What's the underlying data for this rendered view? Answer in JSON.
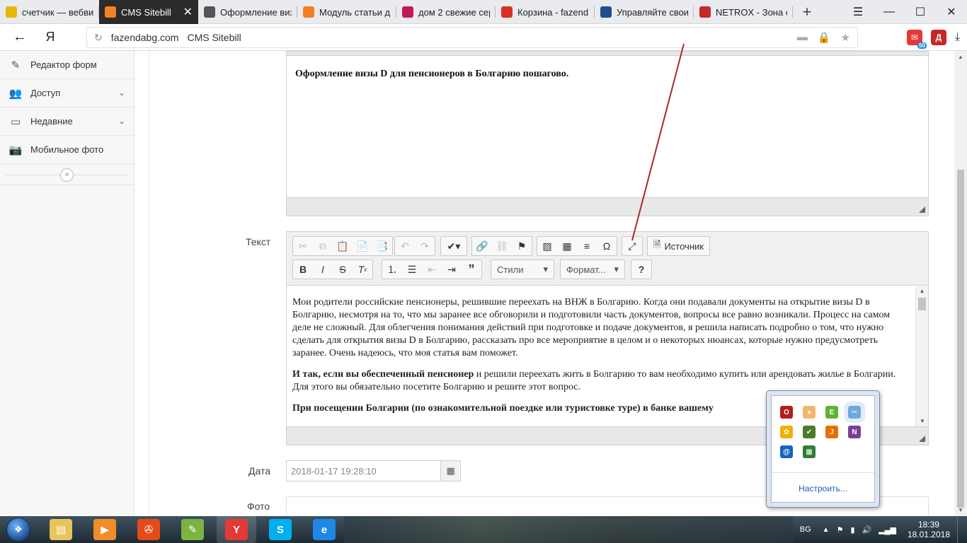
{
  "browser": {
    "tabs": [
      {
        "title": "счетчик — вебви",
        "favicon": "yandex-metrika-icon",
        "color": "#e8b700"
      },
      {
        "title": "CMS Sitebill",
        "favicon": "sitebill-icon",
        "color": "#f48024",
        "active": true
      },
      {
        "title": "Оформление виз",
        "favicon": "house-icon",
        "color": "#555555"
      },
      {
        "title": "Модуль статьи д",
        "favicon": "sitebill-icon",
        "color": "#f48024"
      },
      {
        "title": "дом 2 свежие сер",
        "favicon": "dom2-icon",
        "color": "#c2185b"
      },
      {
        "title": "Корзина - fazend",
        "favicon": "gmail-icon",
        "color": "#d93025"
      },
      {
        "title": "Управляйте свои",
        "favicon": "blogger-b-icon",
        "color": "#1e4e8c"
      },
      {
        "title": "NETROX - Зона о",
        "favicon": "netrox-icon",
        "color": "#c62828"
      }
    ],
    "close_glyph": "✕",
    "new_tab_glyph": "+",
    "window_controls": {
      "menu": "☰",
      "minimize": "—",
      "maximize": "☐",
      "close": "✕"
    },
    "back_glyph": "←",
    "yandex_glyph": "Я",
    "url_domain": "fazendabg.com",
    "url_title": "CMS Sitebill",
    "extensions": [
      {
        "name": "mail-icon",
        "color": "#e53935",
        "badge": "50"
      },
      {
        "name": "d-icon",
        "color": "#c62828",
        "label": "Д"
      }
    ]
  },
  "sidebar": {
    "items": [
      {
        "label": "Редактор форм",
        "icon": "edit-icon",
        "glyph": "✎"
      },
      {
        "label": "Доступ",
        "icon": "users-icon",
        "glyph": "👥",
        "expandable": true
      },
      {
        "label": "Недавние",
        "icon": "monitor-icon",
        "glyph": "▭",
        "expandable": true
      },
      {
        "label": "Мобильное фото",
        "icon": "camera-icon",
        "glyph": "📷"
      }
    ],
    "collapse_glyph": "«"
  },
  "form": {
    "intro_text": "Оформление визы D для пенсионеров в Болгарию пошагово.",
    "text_label": "Текст",
    "toolbar": {
      "source_label": "Источник",
      "styles_label": "Стили",
      "format_label": "Формат...",
      "help_label": "?"
    },
    "text_paragraphs": [
      {
        "bold": "",
        "rest": " Мои родители российские пенсионеры, решившие переехать на ВНЖ в Болгарию. Когда они подавали документы на открытие  визы D в Болгарию, несмотря на то, что  мы заранее все обговорили и подготовили часть документов, вопросы все равно возникали. Процесс на самом деле не сложный. Для облегчения понимания действий при подготовке и подаче документов, я решила написать подробно о том, что нужно сделать для открытия визы D в Болгарию, рассказать про все мероприятие в целом и о некоторых нюансах, которые нужно предусмотреть заранее. Очень надеюсь, что моя статья вам поможет."
      },
      {
        "bold": "И так, если вы обеспеченный пенсионер",
        "rest": " и решили переехать жить в Болгарию то вам необходимо купить или арендовать жилье в Болгарии. Для этого вы обязательно посетите Болгарию и решите этот вопрос."
      },
      {
        "bold": "При посещении Болгарии (по ознакомительной поездке или туристовке туре) в банке вашему",
        "rest": ""
      }
    ],
    "date_label": "Дата",
    "date_value": "2018-01-17 19:28:10",
    "photo_label": "Фото"
  },
  "tray_popup": {
    "icons": [
      {
        "name": "opera-icon",
        "color": "#b71c1c",
        "glyph": "O"
      },
      {
        "name": "cheese-icon",
        "color": "#f4b66a",
        "glyph": "●"
      },
      {
        "name": "evernote-icon",
        "color": "#5fb236",
        "glyph": "E"
      },
      {
        "name": "snipping-icon",
        "color": "#6fa8dc",
        "glyph": "✂"
      },
      {
        "name": "flower-icon",
        "color": "#f2b000",
        "glyph": "✿"
      },
      {
        "name": "checker-icon",
        "color": "#4e7a2b",
        "glyph": "✔"
      },
      {
        "name": "java-icon",
        "color": "#e76f00",
        "glyph": "J"
      },
      {
        "name": "onenote-icon",
        "color": "#7b3f98",
        "glyph": "N"
      },
      {
        "name": "at-icon",
        "color": "#1565c0",
        "glyph": "@"
      },
      {
        "name": "avg-icon",
        "color": "#2e7d32",
        "glyph": "▦"
      }
    ],
    "configure_label": "Настроить..."
  },
  "taskbar": {
    "start_glyph": "❖",
    "apps": [
      {
        "name": "explorer-icon",
        "color": "#e8c45a",
        "glyph": "▤"
      },
      {
        "name": "media-player-icon",
        "color": "#f28c28",
        "glyph": "▶"
      },
      {
        "name": "reel-icon",
        "color": "#e64a19",
        "glyph": "✇"
      },
      {
        "name": "editor-icon",
        "color": "#7cb342",
        "glyph": "✎"
      },
      {
        "name": "yandex-browser-icon",
        "color": "#e53935",
        "glyph": "Y",
        "active": true
      },
      {
        "name": "skype-icon",
        "color": "#00aff0",
        "glyph": "S"
      },
      {
        "name": "ie-icon",
        "color": "#1e88e5",
        "glyph": "e"
      }
    ],
    "tray": {
      "language": "BG",
      "time": "18:39",
      "date": "18.01.2018"
    }
  }
}
